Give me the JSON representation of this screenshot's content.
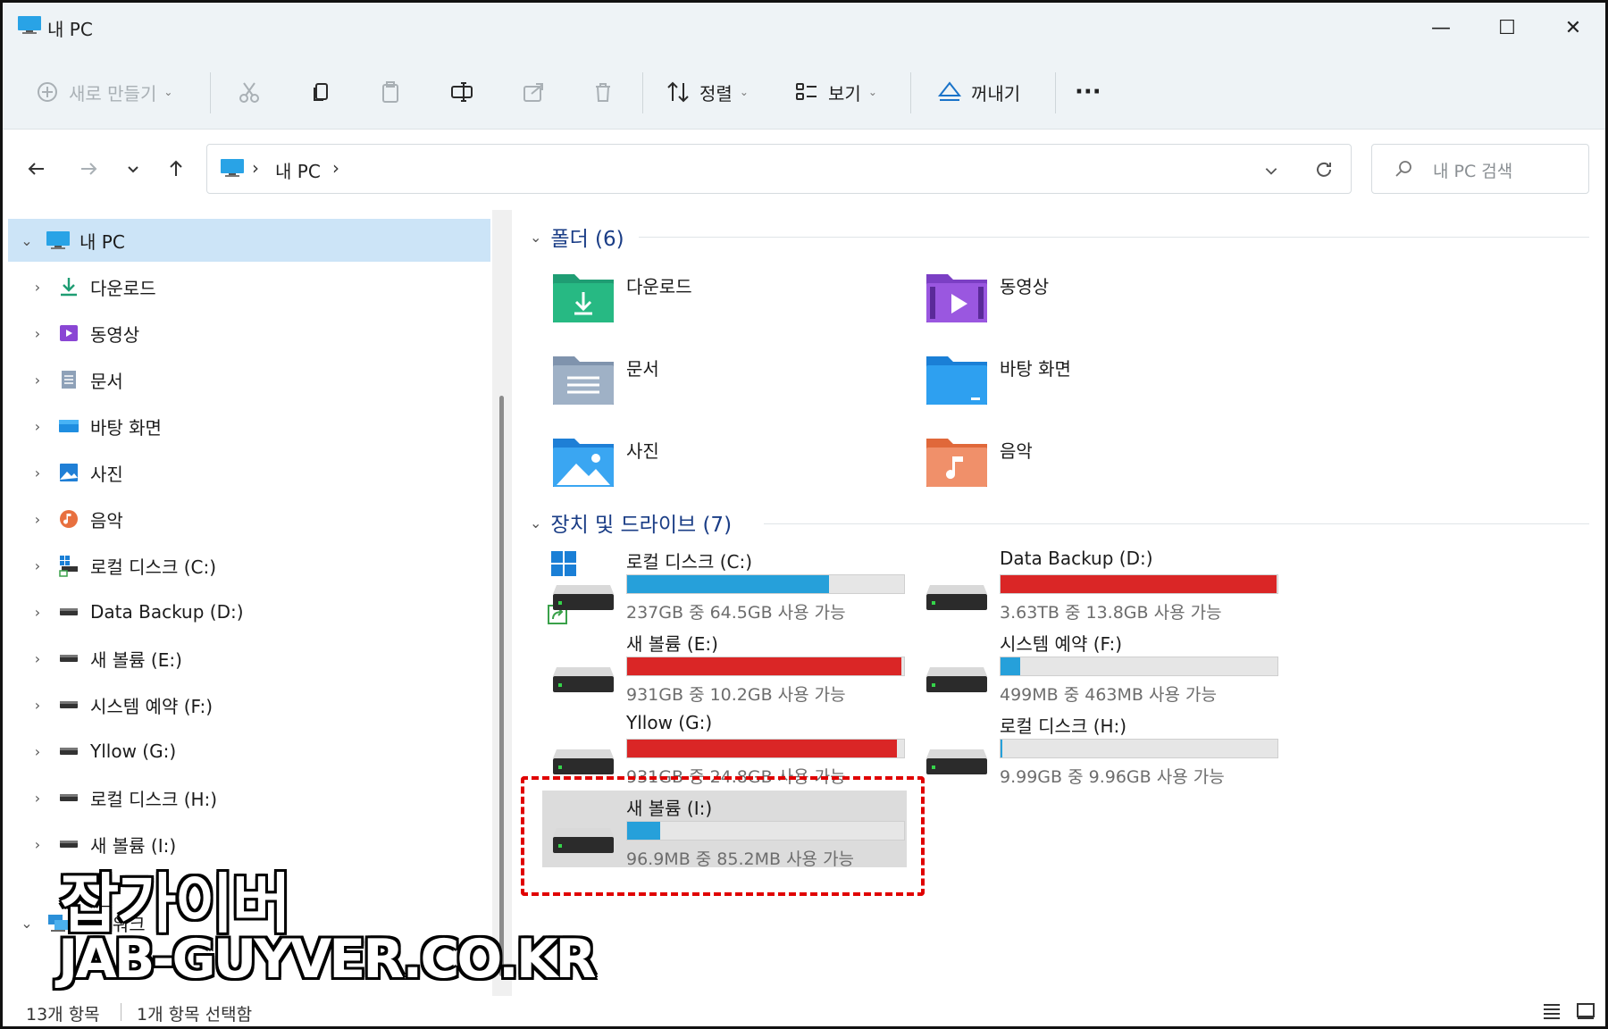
{
  "window": {
    "title": "내 PC",
    "controls": {
      "minimize": "—",
      "maximize": "☐",
      "close": "✕"
    }
  },
  "toolbar": {
    "new_label": "새로 만들기",
    "sort_label": "정렬",
    "view_label": "보기",
    "eject_label": "꺼내기",
    "more_label": "···"
  },
  "address": {
    "crumb": "내 PC",
    "search_placeholder": "내 PC 검색"
  },
  "nav": {
    "items": [
      {
        "label": "내 PC",
        "icon": "pc-icon",
        "expanded": true
      },
      {
        "label": "다운로드",
        "icon": "download-folder-icon"
      },
      {
        "label": "동영상",
        "icon": "videos-folder-icon"
      },
      {
        "label": "문서",
        "icon": "documents-folder-icon"
      },
      {
        "label": "바탕 화면",
        "icon": "desktop-folder-icon"
      },
      {
        "label": "사진",
        "icon": "pictures-folder-icon"
      },
      {
        "label": "음악",
        "icon": "music-folder-icon"
      },
      {
        "label": "로컬 디스크 (C:)",
        "icon": "system-drive-icon"
      },
      {
        "label": "Data Backup (D:)",
        "icon": "drive-icon"
      },
      {
        "label": "새 볼륨 (E:)",
        "icon": "drive-icon"
      },
      {
        "label": "시스템 예약 (F:)",
        "icon": "drive-icon"
      },
      {
        "label": "Yllow (G:)",
        "icon": "drive-icon"
      },
      {
        "label": "로컬 디스크 (H:)",
        "icon": "drive-icon"
      },
      {
        "label": "새 볼륨 (I:)",
        "icon": "drive-icon"
      },
      {
        "label": "네트워크",
        "icon": "network-icon",
        "expanded": true
      }
    ]
  },
  "content": {
    "folders_header": "폴더 (6)",
    "drives_header": "장치 및 드라이브 (7)",
    "folders": [
      {
        "name": "다운로드",
        "icon": "download-folder-icon"
      },
      {
        "name": "동영상",
        "icon": "videos-folder-icon"
      },
      {
        "name": "문서",
        "icon": "documents-folder-icon"
      },
      {
        "name": "바탕 화면",
        "icon": "desktop-folder-icon"
      },
      {
        "name": "사진",
        "icon": "pictures-folder-icon"
      },
      {
        "name": "음악",
        "icon": "music-folder-icon"
      }
    ],
    "drives": [
      {
        "name": "로컬 디스크 (C:)",
        "info": "237GB 중 64.5GB 사용 가능",
        "used_fraction": 0.73,
        "color": "#26a0da"
      },
      {
        "name": "Data Backup (D:)",
        "info": "3.63TB 중 13.8GB 사용 가능",
        "used_fraction": 0.996,
        "color": "#da2626"
      },
      {
        "name": "새 볼륨 (E:)",
        "info": "931GB 중 10.2GB 사용 가능",
        "used_fraction": 0.989,
        "color": "#da2626"
      },
      {
        "name": "시스템 예약 (F:)",
        "info": "499MB 중 463MB 사용 가능",
        "used_fraction": 0.07,
        "color": "#26a0da"
      },
      {
        "name": "Yllow (G:)",
        "info": "931GB 중 24.8GB 사용 가능",
        "used_fraction": 0.973,
        "color": "#da2626"
      },
      {
        "name": "로컬 디스크 (H:)",
        "info": "9.99GB 중 9.96GB 사용 가능",
        "used_fraction": 0.003,
        "color": "#26a0da"
      },
      {
        "name": "새 볼륨 (I:)",
        "info": "96.9MB 중 85.2MB 사용 가능",
        "used_fraction": 0.12,
        "color": "#26a0da"
      }
    ]
  },
  "status": {
    "item_count": "13개 항목",
    "selected": "1개 항목 선택함"
  },
  "watermark": {
    "line1": "잡가이버",
    "line2": "JAB-GUYVER.CO.KR"
  }
}
